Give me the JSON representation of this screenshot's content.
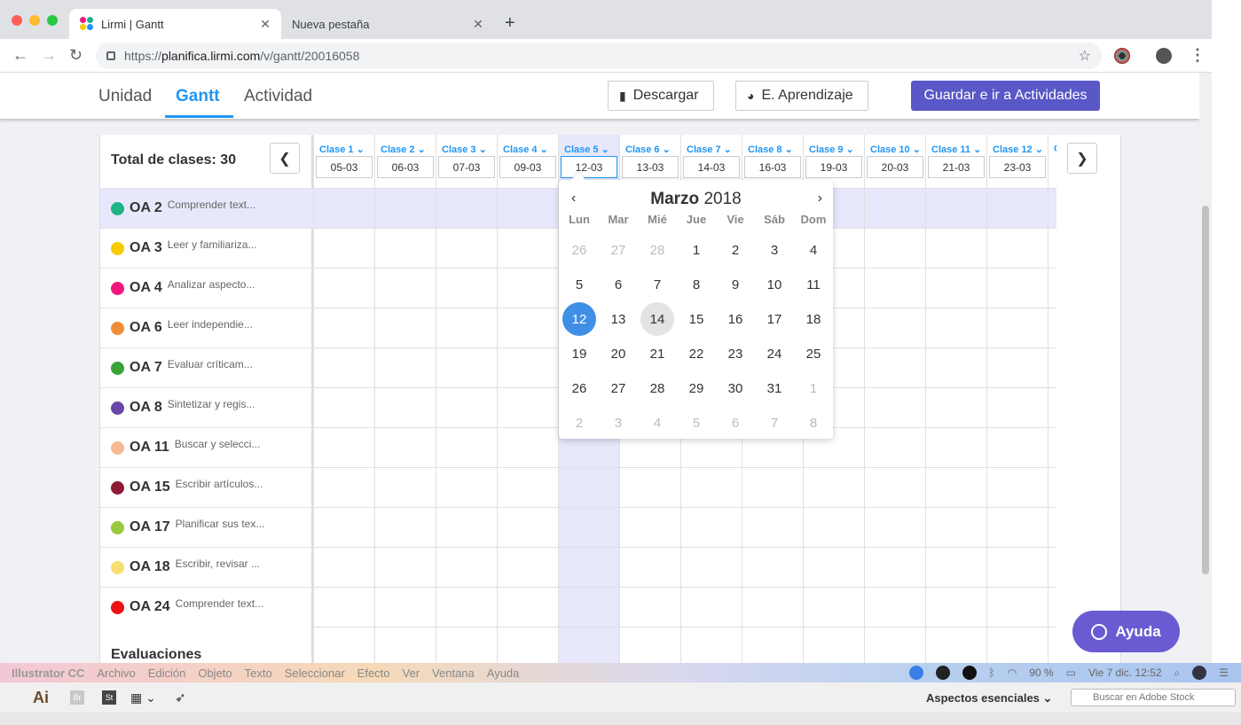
{
  "browser": {
    "tabs": [
      {
        "title": "Lirmi | Gantt",
        "active": true
      },
      {
        "title": "Nueva pestaña",
        "active": false
      }
    ],
    "url_prefix": "https://",
    "url_host": "planifica.lirmi.com",
    "url_path": "/v/gantt/20016058"
  },
  "header": {
    "tabs": [
      "Unidad",
      "Gantt",
      "Actividad"
    ],
    "selected_tab": "Gantt",
    "download_label": "Descargar",
    "learning_label": "E. Aprendizaje",
    "save_label": "Guardar e ir a Actividades"
  },
  "gantt": {
    "total_label": "Total de clases: 30",
    "columns": [
      {
        "label": "Clase 1",
        "date": "05-03"
      },
      {
        "label": "Clase 2",
        "date": "06-03"
      },
      {
        "label": "Clase 3",
        "date": "07-03"
      },
      {
        "label": "Clase 4",
        "date": "09-03"
      },
      {
        "label": "Clase 5",
        "date": "12-03"
      },
      {
        "label": "Clase 6",
        "date": "13-03"
      },
      {
        "label": "Clase 7",
        "date": "14-03"
      },
      {
        "label": "Clase 8",
        "date": "16-03"
      },
      {
        "label": "Clase 9",
        "date": "19-03"
      },
      {
        "label": "Clase 10",
        "date": "20-03"
      },
      {
        "label": "Clase 11",
        "date": "21-03"
      },
      {
        "label": "Clase 12",
        "date": "23-03"
      },
      {
        "label": "C",
        "date": ""
      }
    ],
    "selected_column": "Clase 5",
    "rows": [
      {
        "code": "OA 2",
        "desc": "Comprender text...",
        "color": "#1fb386"
      },
      {
        "code": "OA 3",
        "desc": "Leer y familiariza...",
        "color": "#f5cc00"
      },
      {
        "code": "OA 4",
        "desc": "Analizar aspecto...",
        "color": "#f0167c"
      },
      {
        "code": "OA 6",
        "desc": "Leer independie...",
        "color": "#ef8c3a"
      },
      {
        "code": "OA 7",
        "desc": "Evaluar críticam...",
        "color": "#3aa335"
      },
      {
        "code": "OA 8",
        "desc": "Sintetizar y regis...",
        "color": "#6a46a8"
      },
      {
        "code": "OA 11",
        "desc": "Buscar y selecci...",
        "color": "#f7b98f"
      },
      {
        "code": "OA 15",
        "desc": "Escribir artículos...",
        "color": "#8c1c35"
      },
      {
        "code": "OA 17",
        "desc": "Planificar sus tex...",
        "color": "#96c93d"
      },
      {
        "code": "OA 18",
        "desc": "Escribir, revisar ...",
        "color": "#f7df72"
      },
      {
        "code": "OA 24",
        "desc": "Comprender text...",
        "color": "#ee1111"
      }
    ],
    "evaluations_label": "Evaluaciones"
  },
  "datepicker": {
    "month": "Marzo",
    "year": "2018",
    "weekdays": [
      "Lun",
      "Mar",
      "Mié",
      "Jue",
      "Vie",
      "Sáb",
      "Dom"
    ],
    "weeks": [
      [
        "26",
        "27",
        "28",
        "1",
        "2",
        "3",
        "4"
      ],
      [
        "5",
        "6",
        "7",
        "8",
        "9",
        "10",
        "11"
      ],
      [
        "12",
        "13",
        "14",
        "15",
        "16",
        "17",
        "18"
      ],
      [
        "19",
        "20",
        "21",
        "22",
        "23",
        "24",
        "25"
      ],
      [
        "26",
        "27",
        "28",
        "29",
        "30",
        "31",
        "1"
      ],
      [
        "2",
        "3",
        "4",
        "5",
        "6",
        "7",
        "8"
      ]
    ],
    "selected_day": "12",
    "highlighted_day": "14"
  },
  "help_label": "Ayuda",
  "menubar": {
    "items": [
      "Illustrator CC",
      "Archivo",
      "Edición",
      "Objeto",
      "Texto",
      "Seleccionar",
      "Efecto",
      "Ver",
      "Ventana",
      "Ayuda"
    ],
    "battery": "90 %",
    "clock": "Vie 7 dic.  12:52"
  },
  "illustrator": {
    "logo": "Ai",
    "br": "Br",
    "st": "St",
    "workspace": "Aspectos esenciales",
    "search_placeholder": "Buscar en Adobe Stock"
  }
}
